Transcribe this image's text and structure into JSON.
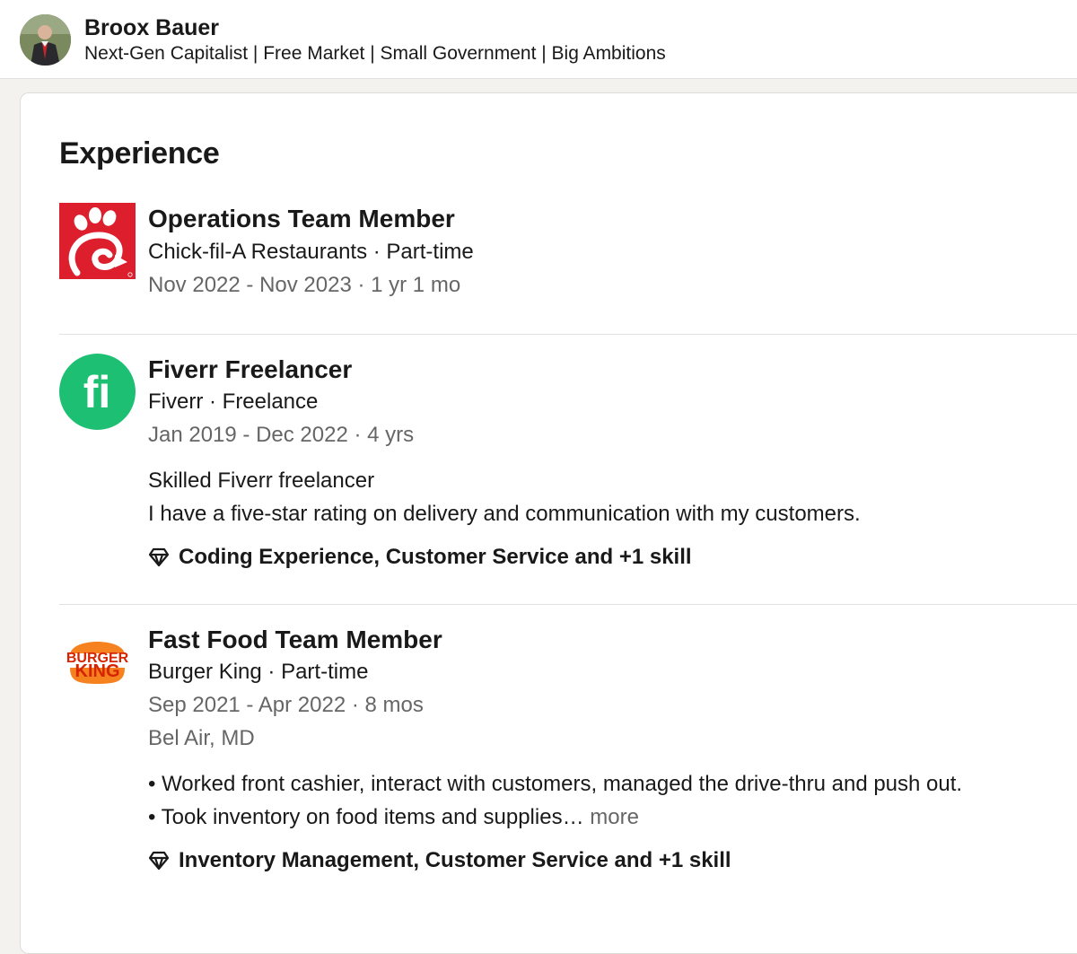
{
  "profile": {
    "name": "Broox Bauer",
    "headline": "Next-Gen Capitalist | Free Market | Small Government | Big Ambitions"
  },
  "experience": {
    "title": "Experience",
    "entries": [
      {
        "role": "Operations Team Member",
        "company": "Chick-fil-A Restaurants · Part-time",
        "dates": "Nov 2022 - Nov 2023 · 1 yr 1 mo",
        "logo_icon": "chick-fil-a-logo-icon"
      },
      {
        "role": "Fiverr Freelancer",
        "company": "Fiverr · Freelance",
        "dates": "Jan 2019 - Dec 2022 · 4 yrs",
        "logo_icon": "fiverr-logo-icon",
        "logo_text": "fi",
        "description": [
          "Skilled Fiverr freelancer",
          "I have a five-star rating on delivery and communication with my customers."
        ],
        "skills": "Coding Experience, Customer Service and +1 skill"
      },
      {
        "role": "Fast Food Team Member",
        "company": "Burger King · Part-time",
        "dates": "Sep 2021 - Apr 2022 · 8 mos",
        "location": "Bel Air, MD",
        "logo_icon": "burger-king-logo-icon",
        "logo_text": [
          "BURGER",
          "KING"
        ],
        "description": [
          "• Worked front cashier, interact with customers, managed the drive-thru and push out.",
          "• Took inventory on food items and supplies…"
        ],
        "more_label": "more",
        "skills": "Inventory Management, Customer Service and +1 skill"
      }
    ]
  },
  "colors": {
    "chick_fil_a_red": "#dd1f2d",
    "fiverr_green": "#1dbf73",
    "burger_king_orange": "#f5821f",
    "burger_king_text": "#d62300",
    "secondary_text": "#666666",
    "page_background": "#f4f2ee"
  },
  "icons": {
    "skills": "diamond-icon"
  }
}
